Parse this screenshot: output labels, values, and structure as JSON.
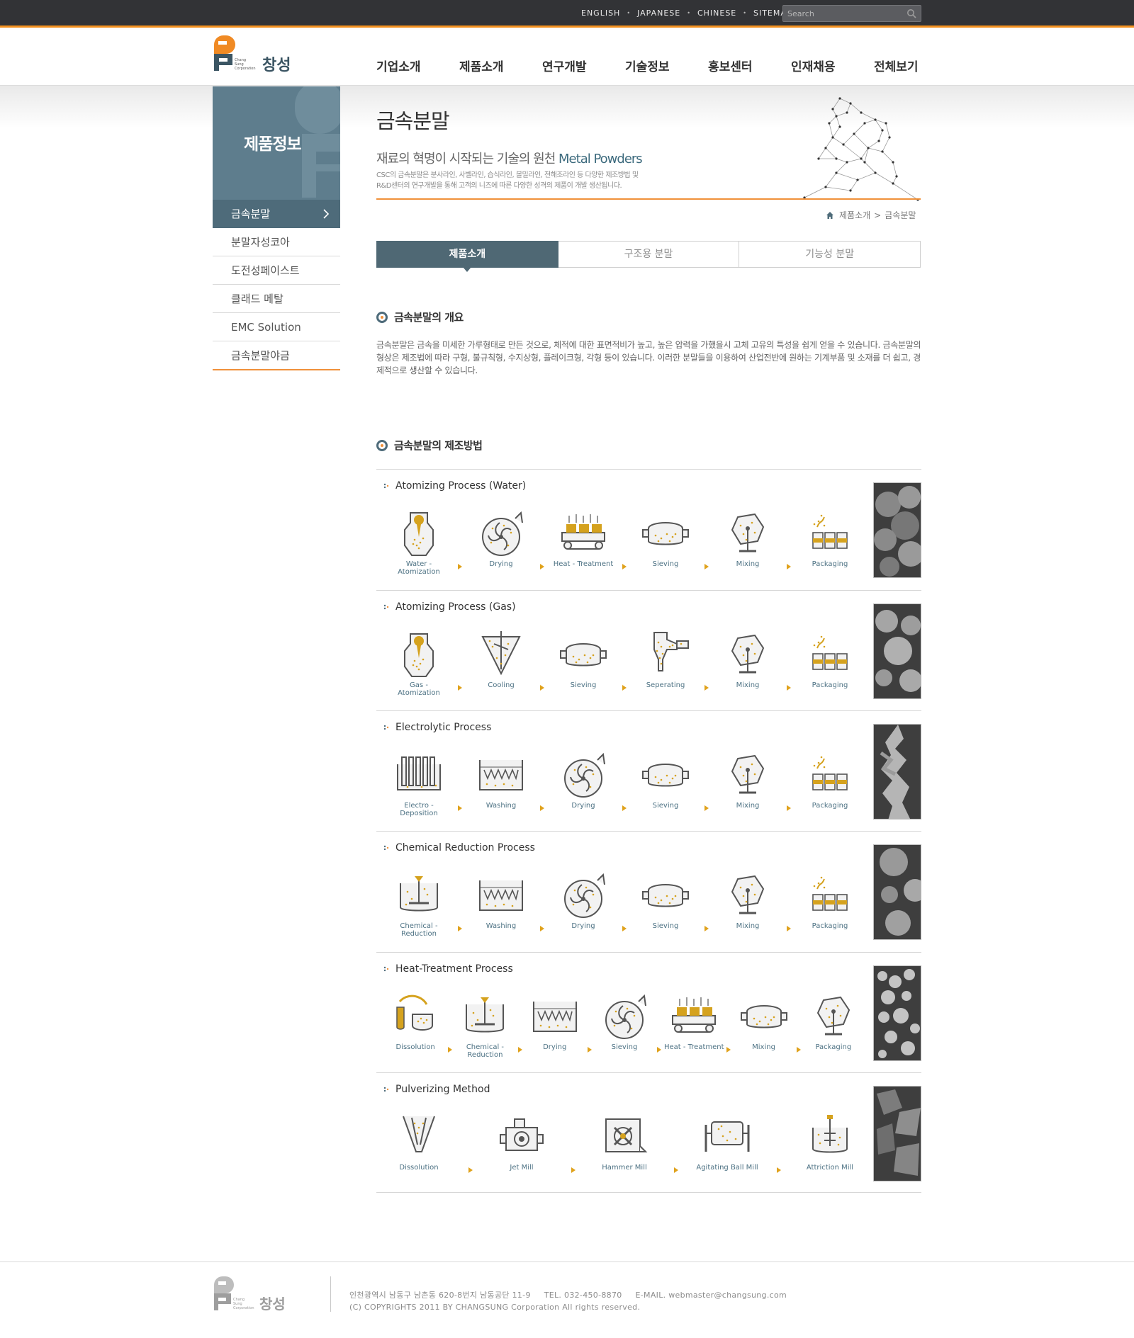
{
  "utility": {
    "links": [
      "ENGLISH",
      "JAPANESE",
      "CHINESE",
      "SITEMAP"
    ],
    "search_placeholder": "Search"
  },
  "brand": {
    "logo_text": "창성",
    "logo_en": [
      "Chang",
      "Sung",
      "Corporation"
    ]
  },
  "gnb": [
    "기업소개",
    "제품소개",
    "연구개발",
    "기술정보",
    "홍보센터",
    "인재채용",
    "전체보기"
  ],
  "sidebar": {
    "title": "제품정보",
    "items": [
      "금속분말",
      "분말자성코아",
      "도전성페이스트",
      "클래드 메탈",
      "EMC Solution",
      "금속분말야금"
    ]
  },
  "page": {
    "title": "금속분말",
    "subtitle_ko": "재료의 혁명이 시작되는 기술의 원천",
    "subtitle_en": "Metal Powders",
    "desc_line1": "CSC의 금속분말은 분사라인, 사벨라인, 습식라인, 볼밀라인, 전해조라인 등 다양한 제조방법 및",
    "desc_line2": "R&D센터의 연구개발을 통해 고객의 니즈에 따른 다양한 성격의 제품이 개발 생산됩니다."
  },
  "breadcrumb": [
    "제품소개",
    "금속분말"
  ],
  "tabs": [
    "제품소개",
    "구조용 분말",
    "기능성 분말"
  ],
  "overview": {
    "title": "금속분말의 개요",
    "text": "금속분말은 금속을 미세한 가루형태로 만든 것으로, 체적에 대한 표면적비가 높고, 높은 압력을 가했을시 고체 고유의 특성을 쉽게 얻을 수 있습니다. 금속분말의 형상은 제조법에 따라 구형, 불규칙형, 수지상형, 플레이크형, 각형 등이 있습니다. 이러한 분말들을 이용하여 산업전반에 원하는 기계부품 및 소재를 더 쉽고, 경제적으로 생산할 수 있습니다."
  },
  "method": {
    "title": "금속분말의 제조방법",
    "processes": [
      {
        "title": "Atomizing Process (Water)",
        "steps": [
          [
            "Water -",
            "Atomization"
          ],
          [
            "Drying"
          ],
          [
            "Heat - Treatment"
          ],
          [
            "Sieving"
          ],
          [
            "Mixing"
          ],
          [
            "Packaging"
          ]
        ]
      },
      {
        "title": "Atomizing Process (Gas)",
        "steps": [
          [
            "Gas -",
            "Atomization"
          ],
          [
            "Cooling"
          ],
          [
            "Sieving"
          ],
          [
            "Seperating"
          ],
          [
            "Mixing"
          ],
          [
            "Packaging"
          ]
        ]
      },
      {
        "title": "Electrolytic Process",
        "steps": [
          [
            "Electro -",
            "Deposition"
          ],
          [
            "Washing"
          ],
          [
            "Drying"
          ],
          [
            "Sieving"
          ],
          [
            "Mixing"
          ],
          [
            "Packaging"
          ]
        ]
      },
      {
        "title": "Chemical Reduction Process",
        "steps": [
          [
            "Chemical -",
            "Reduction"
          ],
          [
            "Washing"
          ],
          [
            "Drying"
          ],
          [
            "Sieving"
          ],
          [
            "Mixing"
          ],
          [
            "Packaging"
          ]
        ]
      },
      {
        "title": "Heat-Treatment Process",
        "steps": [
          [
            "Dissolution"
          ],
          [
            "Chemical -",
            "Reduction"
          ],
          [
            "Drying"
          ],
          [
            "Sieving"
          ],
          [
            "Heat - Treatment"
          ],
          [
            "Mixing"
          ],
          [
            "Packaging"
          ]
        ]
      },
      {
        "title": "Pulverizing Method",
        "steps": [
          [
            "Dissolution"
          ],
          [
            "Jet Mill"
          ],
          [
            "Hammer Mill"
          ],
          [
            "Agitating Ball Mill"
          ],
          [
            "Attriction Mill"
          ]
        ]
      }
    ]
  },
  "footer": {
    "address": "인천광역시 남동구 남촌동 620-8번지 남동공단 11-9     TEL. 032-450-8870     E-MAIL. webmaster@changsung.com",
    "copyright": "(C) COPYRIGHTS 2011 BY CHANGSUNG Corporation All rights reserved."
  },
  "colors": {
    "accent": "#f0913a",
    "nav_dark": "#4e6b7a",
    "topbar": "#323336",
    "label": "#4c7183",
    "gold": "#d5a21e"
  }
}
